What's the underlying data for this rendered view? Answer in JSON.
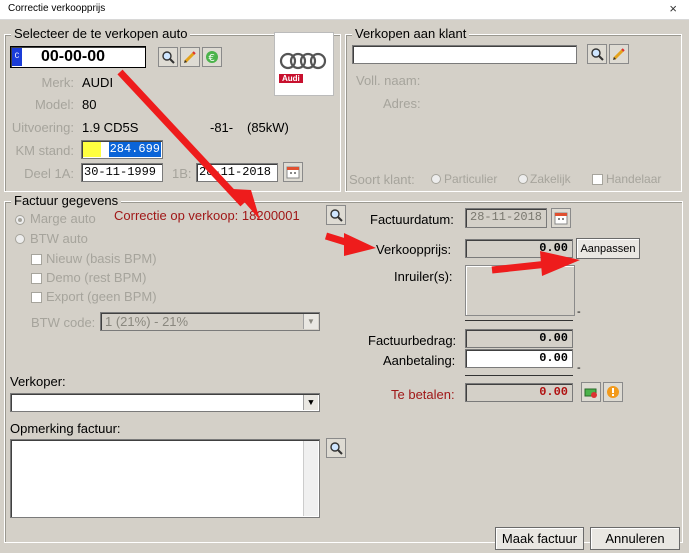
{
  "window": {
    "title": "Correctie verkoopprijs",
    "close_glyph": "×"
  },
  "car": {
    "group_title": "Selecteer de te verkopen auto",
    "plate": "00-00-00",
    "plate_badge": "C",
    "brand_label": "Merk:",
    "brand": "AUDI",
    "model_label": "Model:",
    "model": "80",
    "version_label": "Uitvoering:",
    "version": "1.9 CD5S",
    "version_code": "-81-",
    "power": "(85kW)",
    "km_label": "KM stand:",
    "km": "284.699",
    "part1a_label": "Deel 1A:",
    "part1a": "30-11-1999",
    "part1b_label": "1B:",
    "part1b": "28-11-2018",
    "logo_text": "Audi"
  },
  "customer": {
    "group_title": "Verkopen aan klant",
    "search_value": "",
    "fullname_label": "Voll. naam:",
    "address_label": "Adres:",
    "type_label": "Soort klant:",
    "type_particulier": "Particulier",
    "type_zakelijk": "Zakelijk",
    "type_handelaar": "Handelaar"
  },
  "invoice": {
    "group_title": "Factuur gegevens",
    "marge": "Marge auto",
    "btw_auto": "BTW auto",
    "new": "Nieuw (basis BPM)",
    "demo": "Demo (rest BPM)",
    "export": "Export (geen BPM)",
    "btw_code_label": "BTW code:",
    "btw_code_value": "1 (21%) - 21%",
    "correction": "Correctie op verkoop: 18200001",
    "date_label": "Factuurdatum:",
    "date": "28-11-2018",
    "price_label": "Verkoopprijs:",
    "price": "0.00",
    "adjust": "Aanpassen",
    "tradein_label": "Inruiler(s):",
    "dash": "-",
    "amount_label": "Factuurbedrag:",
    "amount": "0.00",
    "deposit_label": "Aanbetaling:",
    "deposit": "0.00",
    "topay_label": "Te betalen:",
    "topay": "0.00"
  },
  "seller": {
    "label": "Verkoper:",
    "value": ""
  },
  "remark": {
    "label": "Opmerking factuur:",
    "value": ""
  },
  "footer": {
    "make": "Maak factuur",
    "cancel": "Annuleren"
  },
  "colors": {
    "arrow": "#ee1c1c",
    "highlight": "#ffff40",
    "selection": "#0a64d8",
    "dialog": "#d4d0c8"
  }
}
